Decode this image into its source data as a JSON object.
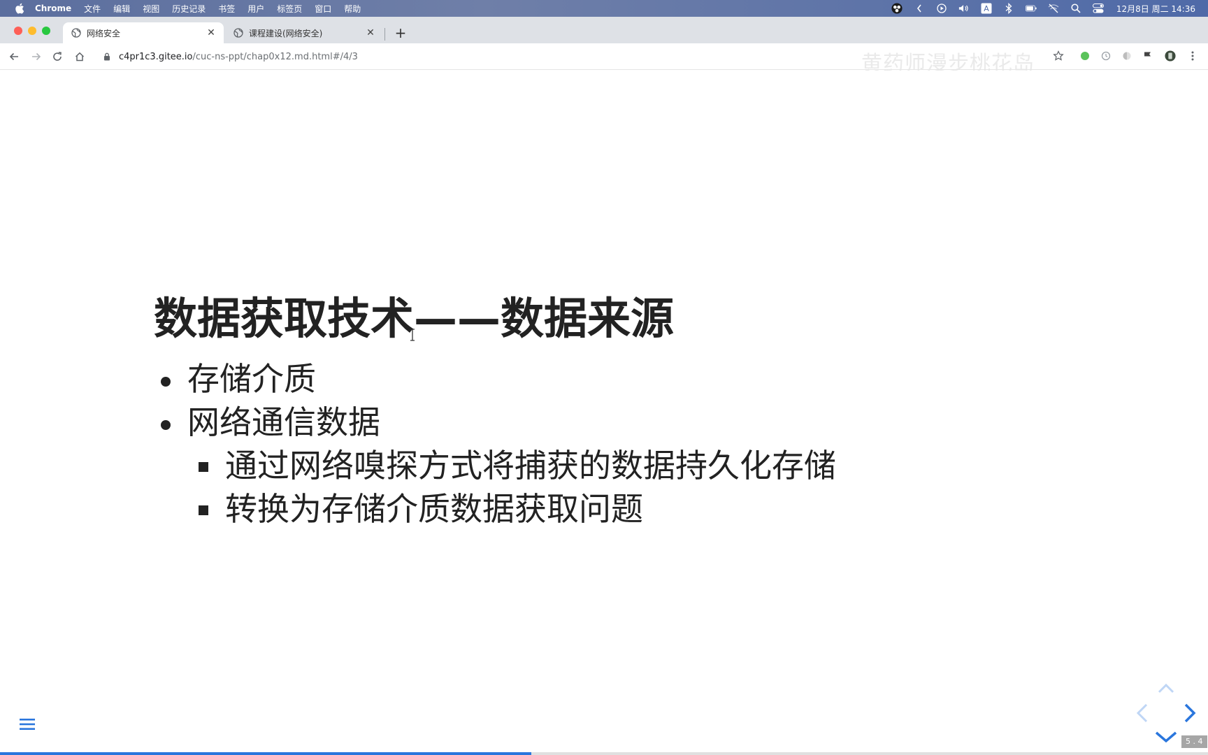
{
  "menubar": {
    "app_name": "Chrome",
    "items": [
      "文件",
      "编辑",
      "视图",
      "历史记录",
      "书签",
      "用户",
      "标签页",
      "窗口",
      "帮助"
    ],
    "clock": "12月8日 周二 14:36",
    "input_method": "A"
  },
  "tabs": [
    {
      "title": "网络安全",
      "active": true
    },
    {
      "title": "课程建设(网络安全)",
      "active": false
    }
  ],
  "toolbar": {
    "url_host": "c4pr1c3.gitee.io",
    "url_path": "/cuc-ns-ppt/chap0x12.md.html#/4/3"
  },
  "watermark": {
    "text": "黄药师漫步桃花岛"
  },
  "slide": {
    "title": "数据获取技术——数据来源",
    "bullets": [
      "存储介质",
      "网络通信数据"
    ],
    "sub_bullets": [
      "通过网络嗅探方式将捕获的数据持久化存储",
      "转换为存储介质数据获取问题"
    ],
    "slide_number": "5 . 4",
    "progress": 0.44
  },
  "colors": {
    "accent": "#2a76dd",
    "text": "#222222"
  }
}
